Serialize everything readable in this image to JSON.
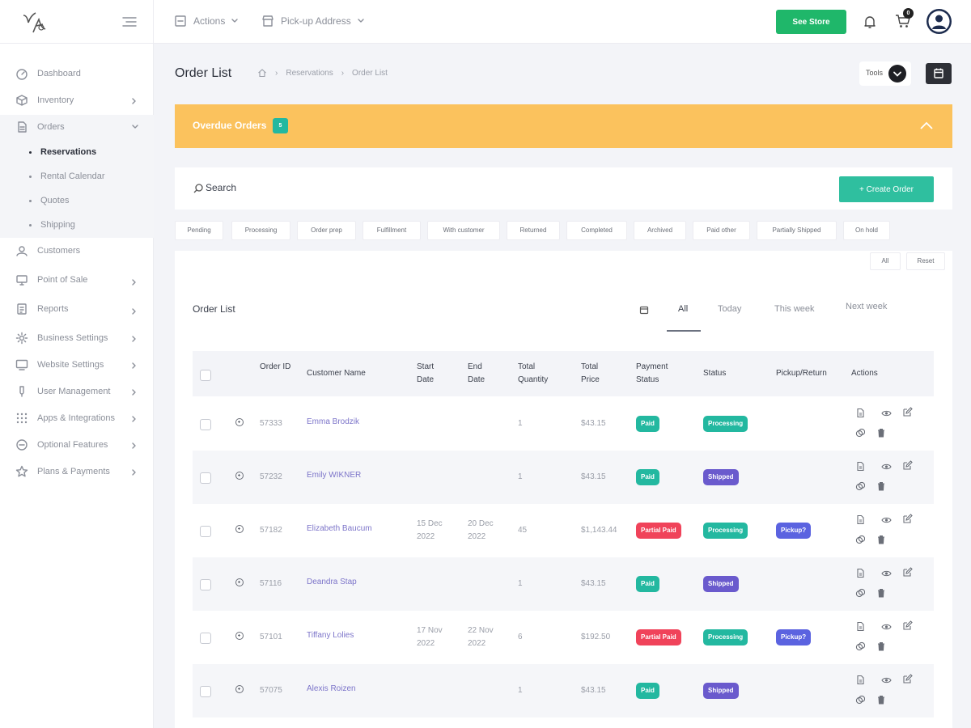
{
  "colors": {
    "accent_green": "#1fb76a",
    "teal": "#2fbf9f",
    "overdue_bg": "#fbc25d",
    "paid": "#23b8a0",
    "partial_paid": "#f0435a",
    "processing": "#23b8a0",
    "shipped": "#6a5acd",
    "pickup": "#5b63e0",
    "link": "#7c74c9"
  },
  "topbar": {
    "actions_label": "Actions",
    "pickup_label": "Pick-up Address",
    "see_store": "See Store",
    "cart_count": "0",
    "icons": [
      "hamburger-icon",
      "bell-icon",
      "cart-icon",
      "user-avatar"
    ]
  },
  "sidebar": {
    "items": [
      {
        "label": "Dashboard",
        "icon": "dashboard-icon"
      },
      {
        "label": "Inventory",
        "icon": "box-icon"
      },
      {
        "label": "Orders",
        "icon": "document-icon"
      },
      {
        "label": "Customers",
        "icon": "customers-icon"
      },
      {
        "label": "Point of Sale",
        "icon": "monitor-icon"
      },
      {
        "label": "Reports",
        "icon": "report-icon"
      },
      {
        "label": "Business Settings",
        "icon": "gear-icon"
      },
      {
        "label": "Website Settings",
        "icon": "desktop-icon"
      },
      {
        "label": "User Management",
        "icon": "user-icon"
      },
      {
        "label": "Apps & Integrations",
        "icon": "grid-icon"
      },
      {
        "label": "Optional Features",
        "icon": "toggle-icon"
      },
      {
        "label": "Plans & Payments",
        "icon": "star-icon"
      }
    ],
    "orders_sub": [
      "Reservations",
      "Rental Calendar",
      "Quotes",
      "Shipping"
    ]
  },
  "header": {
    "title": "Order List",
    "breadcrumb": [
      "Reservations",
      "Order List"
    ],
    "tools_label": "Tools"
  },
  "overdue": {
    "label": "Overdue Orders",
    "count": "5"
  },
  "search": {
    "placeholder": "Search",
    "create_label": "+ Create Order"
  },
  "filters": [
    "Pending",
    "Processing",
    "Order prep",
    "Fulfillment",
    "With customer",
    "Returned",
    "Completed",
    "Archived",
    "Paid other",
    "Partially Shipped",
    "On hold"
  ],
  "list": {
    "all_button": "All",
    "reset_button": "Reset",
    "title": "Order List",
    "date_tabs": [
      "All",
      "Today",
      "This week",
      "Next week"
    ],
    "columns": [
      "Order ID",
      "Customer Name",
      "Start Date",
      "End Date",
      "Total Quantity",
      "Total Price",
      "Payment Status",
      "Status",
      "Pickup/Return",
      "Actions"
    ],
    "rows": [
      {
        "id": "57333",
        "name": "Emma Brodzik",
        "start": "",
        "end": "",
        "qty": "1",
        "price": "$43.15",
        "payment": "Paid",
        "status": "Processing",
        "pickup": ""
      },
      {
        "id": "57232",
        "name": "Emily WIKNER",
        "start": "",
        "end": "",
        "qty": "1",
        "price": "$43.15",
        "payment": "Paid",
        "status": "Shipped",
        "pickup": ""
      },
      {
        "id": "57182",
        "name": "Elizabeth Baucum",
        "start": "15 Dec 2022",
        "end": "20 Dec 2022",
        "qty": "45",
        "price": "$1,143.44",
        "payment": "Partial Paid",
        "status": "Processing",
        "pickup": "Pickup?"
      },
      {
        "id": "57116",
        "name": "Deandra Stap",
        "start": "",
        "end": "",
        "qty": "1",
        "price": "$43.15",
        "payment": "Paid",
        "status": "Shipped",
        "pickup": ""
      },
      {
        "id": "57101",
        "name": "Tiffany Lolies",
        "start": "17 Nov 2022",
        "end": "22 Nov 2022",
        "qty": "6",
        "price": "$192.50",
        "payment": "Partial Paid",
        "status": "Processing",
        "pickup": "Pickup?"
      },
      {
        "id": "57075",
        "name": "Alexis Roizen",
        "start": "",
        "end": "",
        "qty": "1",
        "price": "$43.15",
        "payment": "Paid",
        "status": "Shipped",
        "pickup": ""
      }
    ]
  }
}
